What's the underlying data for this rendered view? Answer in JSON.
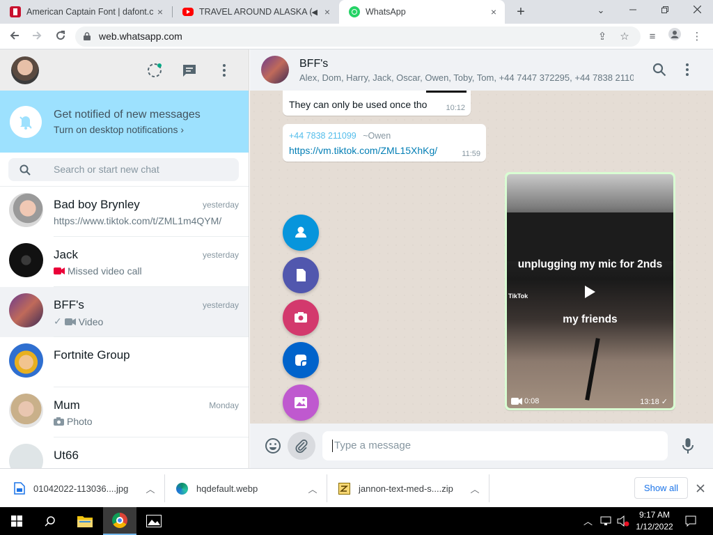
{
  "browser": {
    "tabs": [
      {
        "title": "American Captain Font | dafont.c",
        "icon": "dafont-icon",
        "close": "×"
      },
      {
        "title": "TRAVEL AROUND ALASKA (4",
        "icon": "youtube-icon",
        "close": "×"
      },
      {
        "title": "WhatsApp",
        "icon": "whatsapp-icon",
        "close": "×",
        "active": true
      }
    ],
    "new_tab": "+",
    "url": "web.whatsapp.com"
  },
  "sidebar": {
    "notification": {
      "title": "Get notified of new messages",
      "subtitle": "Turn on desktop notifications ›"
    },
    "search_placeholder": "Search or start new chat",
    "chats": [
      {
        "name": "Bad boy Brynley",
        "time": "yesterday",
        "preview": "https://www.tiktok.com/t/ZML1m4QYM/"
      },
      {
        "name": "Jack",
        "time": "yesterday",
        "preview": "Missed video call"
      },
      {
        "name": "BFF's",
        "time": "yesterday",
        "preview": "Video",
        "selected": true
      },
      {
        "name": "Fortnite Group",
        "time": "",
        "preview": ""
      },
      {
        "name": "Mum",
        "time": "Monday",
        "preview": "Photo"
      },
      {
        "name": "Ut66",
        "time": "",
        "preview": ""
      }
    ]
  },
  "conversation": {
    "group_name": "BFF's",
    "members": "Alex, Dom, Harry, Jack, Oscar, Owen, Toby, Tom, +44 7447 372295, +44 7838 2110...",
    "messages": [
      {
        "text": "They can only be used once tho",
        "time": "10:12"
      },
      {
        "sender_phone": "+44 7838 211099",
        "sender_name": "~Owen",
        "text": "https://vm.tiktok.com/ZML15XhKg/",
        "time": "11:59"
      }
    ],
    "video": {
      "caption_top": "unplugging my mic for 2nds",
      "caption_bottom": "my friends",
      "brand": "TikTok",
      "duration": "0:08",
      "time": "13:18"
    },
    "compose_placeholder": "Type a message"
  },
  "downloads": {
    "items": [
      {
        "name": "01042022-113036....jpg"
      },
      {
        "name": "hqdefault.webp"
      },
      {
        "name": "jannon-text-med-s....zip"
      }
    ],
    "show_all": "Show all"
  },
  "taskbar": {
    "time": "9:17 AM",
    "date": "1/12/2022"
  }
}
